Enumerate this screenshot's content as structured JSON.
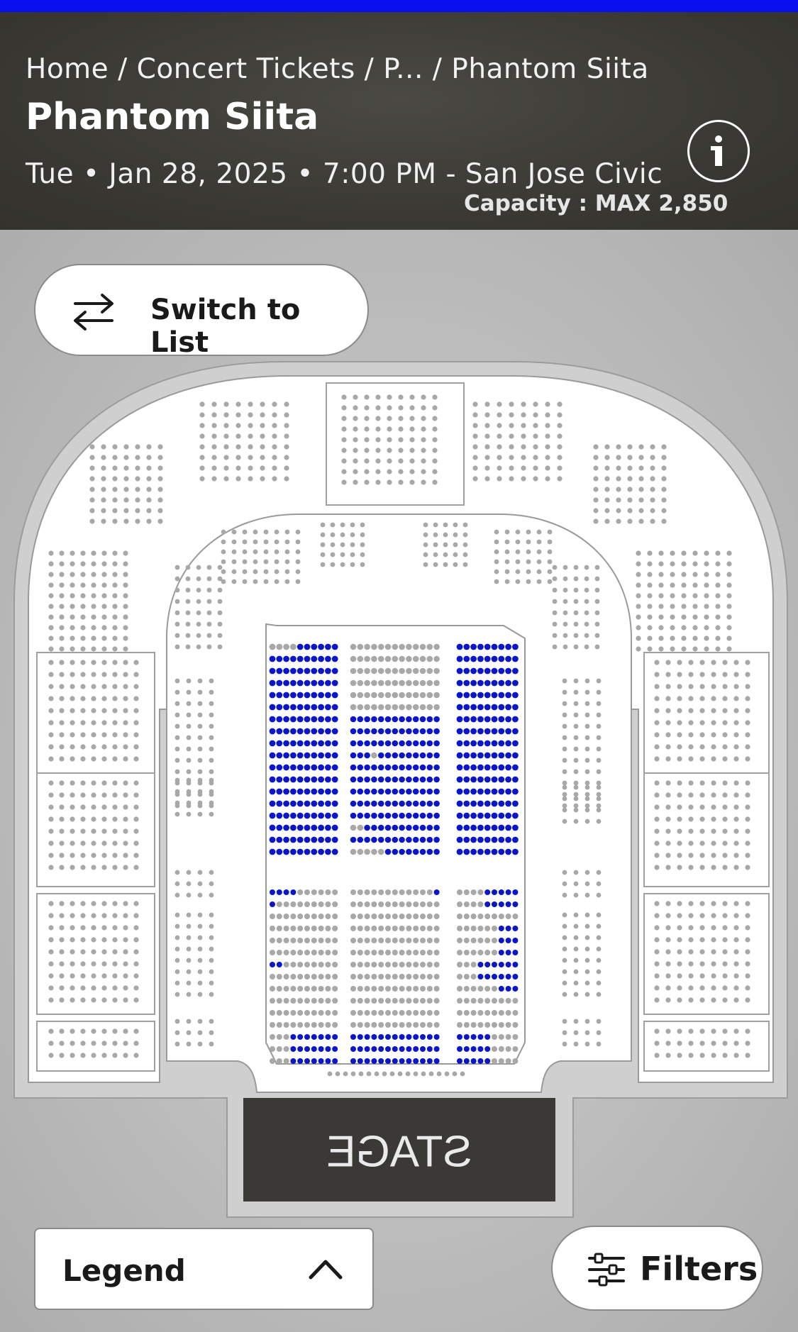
{
  "breadcrumb": {
    "items": [
      "Home",
      "Concert Tickets",
      "P...",
      "Phantom Siita"
    ],
    "separator": " / "
  },
  "event": {
    "title": "Phantom Siita",
    "datetime": "Tue • Jan 28, 2025 • 7:00 PM",
    "venue_separator": " - ",
    "venue": "San Jose Civic",
    "capacity": "Capacity : MAX 2,850"
  },
  "info_icon": "info-icon",
  "switch_button": {
    "label": "Switch to List",
    "icon": "swap-arrows-icon"
  },
  "stage": {
    "label": "STAGE",
    "mirrored": true
  },
  "legend_button": {
    "label": "Legend",
    "icon": "chevron-up-icon"
  },
  "filters_button": {
    "label": "Filters",
    "icon": "sliders-icon"
  },
  "colors": {
    "top_bar": "#0a0ff0",
    "header_bg": "#383732",
    "available_seat": "#0a16c8",
    "unavailable_seat": "#a8a8a8",
    "section_fill": "#ffffff",
    "stage_bg": "#3a3935"
  }
}
